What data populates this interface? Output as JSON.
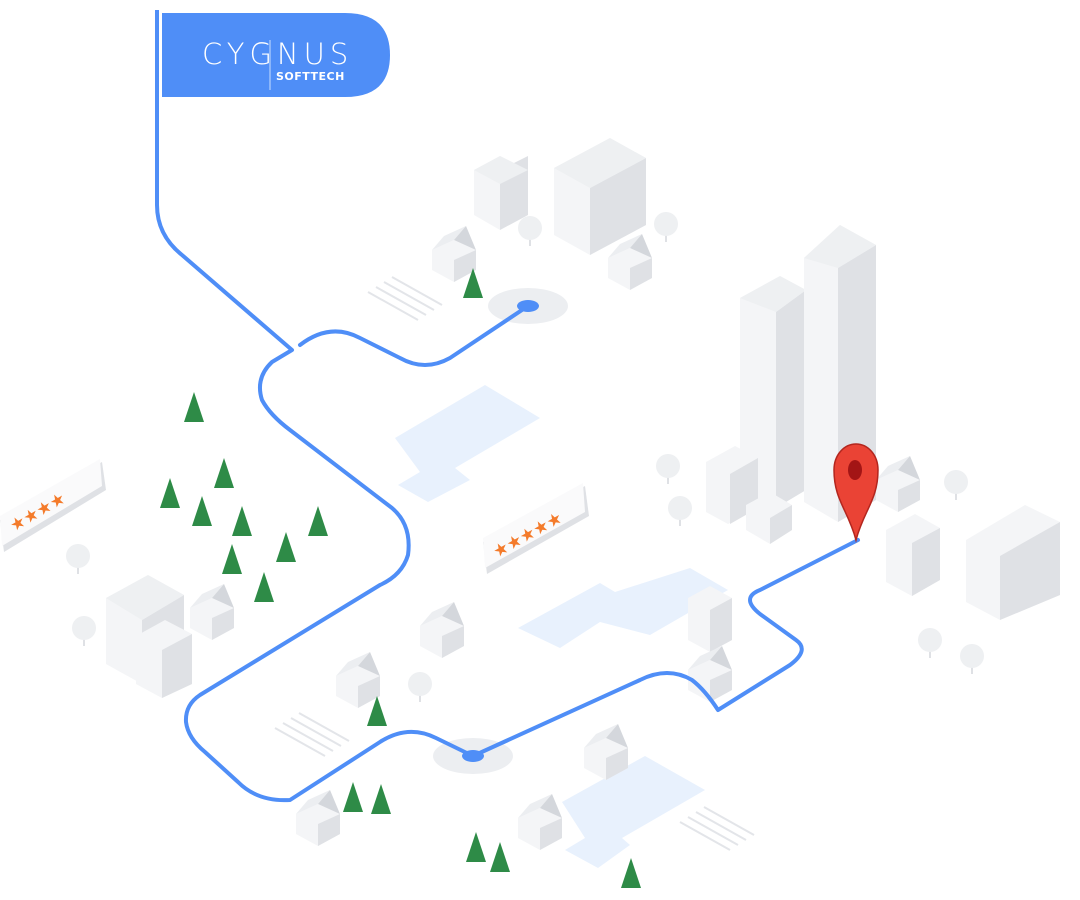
{
  "brand": {
    "name": "CYGNUS",
    "subtitle": "SOFTTECH",
    "flag_color": "#4f8ef7"
  },
  "colors": {
    "route": "#4f8ef7",
    "pin": "#ea4335",
    "pin_dark": "#a31515",
    "tree": "#2e8b47",
    "building_light": "#f4f5f7",
    "building_shade": "#dfe1e5",
    "water": "#e8f1fd",
    "star": "#f47b2b"
  },
  "rating_cards": [
    {
      "id": "left",
      "stars": "★★★★",
      "rating": 4
    },
    {
      "id": "center",
      "stars": "★★★★★",
      "rating": 5
    }
  ],
  "icons": [
    "location-pin-icon",
    "waypoint-icon",
    "star-icon",
    "tree-icon",
    "building-icon",
    "house-icon"
  ]
}
